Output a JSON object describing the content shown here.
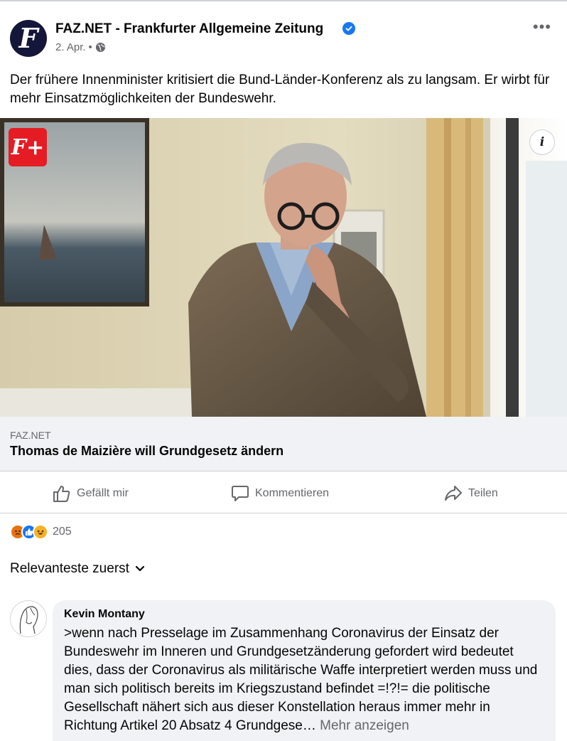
{
  "post": {
    "page_name": "FAZ.NET - Frankfurter Allgemeine Zeitung",
    "date": "2. Apr.",
    "separator": "•",
    "more_label": "•••",
    "text": "Der frühere Innenminister kritisiert die Bund-Länder-Konferenz als zu langsam. Er wirbt für mehr Einsatzmöglichkeiten der Bundeswehr.",
    "avatar_letter": "F",
    "badge_label": "F+",
    "info_label": "i"
  },
  "link": {
    "source": "FAZ.NET",
    "title": "Thomas de Maizière will Grundgesetz ändern"
  },
  "actions": {
    "like": "Gefällt mir",
    "comment": "Kommentieren",
    "share": "Teilen"
  },
  "reactions": {
    "count": "205",
    "icons": [
      "angry-icon",
      "like-icon",
      "haha-icon"
    ]
  },
  "sort": {
    "label": "Relevanteste zuerst"
  },
  "comment": {
    "author": "Kevin Montany",
    "text": ">wenn nach Presselage im Zusammenhang Coronavirus der Einsatz der Bundeswehr im Inneren und Grundgesetzänderung  gefordert wird bedeutet dies, dass der Coronavirus als militärische Waffe interpretiert werden muss und man sich politisch bereits im Kriegszustand befindet =!?!= die politische Gesellschaft nähert sich aus dieser Konstellation heraus immer mehr in Richtung Artikel 20 Absatz 4 Grundgese…",
    "more": "Mehr anzeigen"
  },
  "colors": {
    "brand_blue": "#1877f2",
    "faz_navy": "#14163a",
    "faz_red": "#e51c23",
    "secondary_text": "#65676b",
    "card_bg": "#f0f2f5"
  }
}
